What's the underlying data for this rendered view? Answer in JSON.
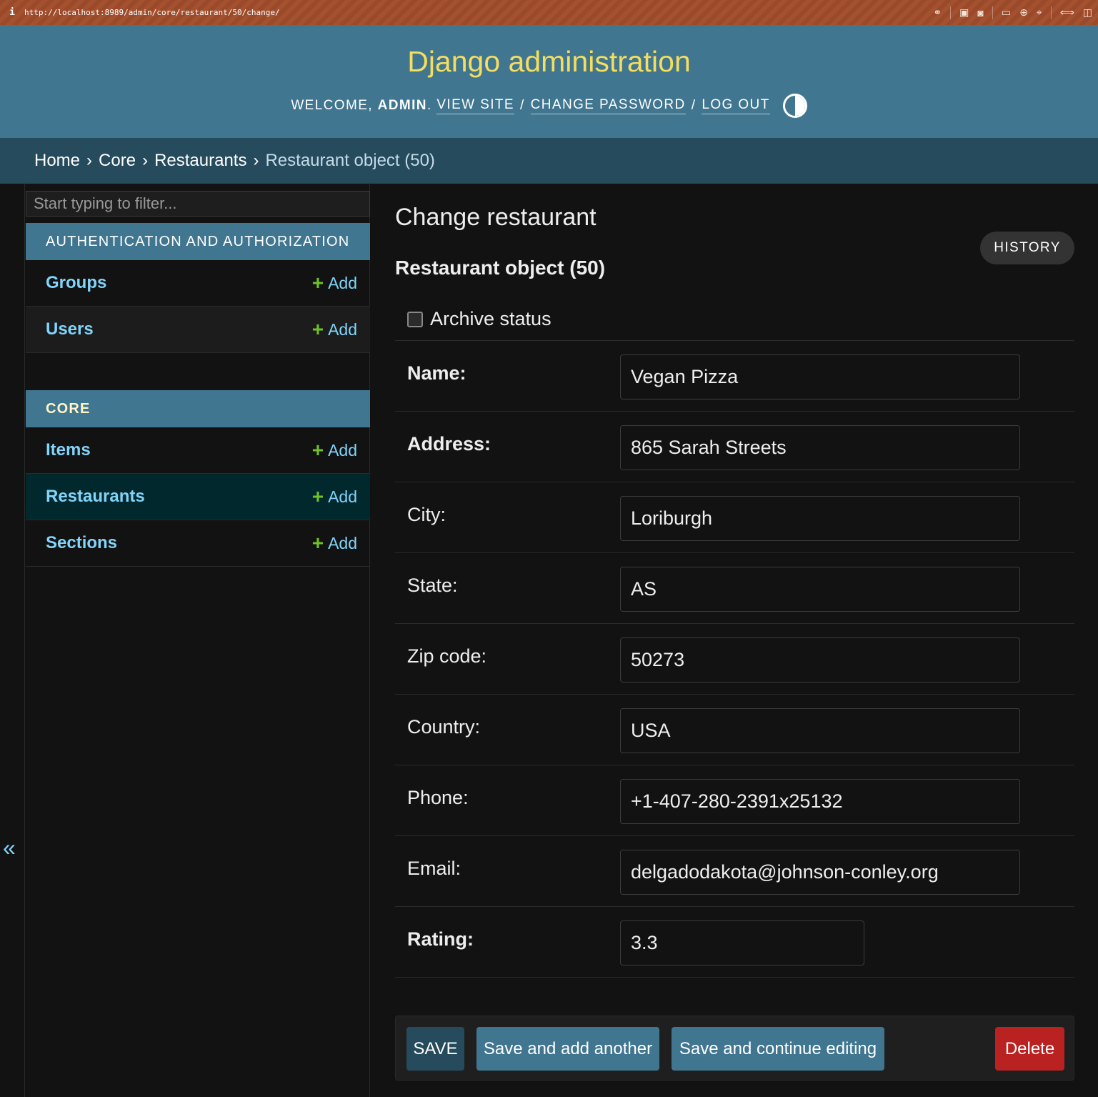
{
  "browser": {
    "info_glyph": "i",
    "url": "http://localhost:8989/admin/core/restaurant/50/change/"
  },
  "header": {
    "brand": "Django administration",
    "welcome": "WELCOME,",
    "user": "ADMIN",
    "user_suffix": ".",
    "view_site": "VIEW SITE",
    "change_password": "CHANGE PASSWORD",
    "log_out": "LOG OUT",
    "slash": "/"
  },
  "breadcrumbs": {
    "home": "Home",
    "app": "Core",
    "model": "Restaurants",
    "current": "Restaurant object (50)",
    "sep": "›"
  },
  "sidebar": {
    "filter_placeholder": "Start typing to filter...",
    "add_label": "Add",
    "modules": [
      {
        "caption": "AUTHENTICATION AND AUTHORIZATION",
        "models": [
          "Groups",
          "Users"
        ]
      },
      {
        "caption": "CORE",
        "models": [
          "Items",
          "Restaurants",
          "Sections"
        ]
      }
    ],
    "collapse_glyph": "«"
  },
  "content": {
    "page_title": "Change restaurant",
    "history_label": "HISTORY",
    "object_title": "Restaurant object (50)",
    "archive_label": "Archive status",
    "archive_checked": false,
    "fields": [
      {
        "label": "Name:",
        "value": "Vegan Pizza",
        "required": true
      },
      {
        "label": "Address:",
        "value": "865 Sarah Streets",
        "required": true
      },
      {
        "label": "City:",
        "value": "Loriburgh",
        "required": false
      },
      {
        "label": "State:",
        "value": "AS",
        "required": false
      },
      {
        "label": "Zip code:",
        "value": "50273",
        "required": false
      },
      {
        "label": "Country:",
        "value": "USA",
        "required": false
      },
      {
        "label": "Phone:",
        "value": "+1-407-280-2391x25132",
        "required": false
      },
      {
        "label": "Email:",
        "value": "delgadodakota@johnson-conley.org",
        "required": false
      },
      {
        "label": "Rating:",
        "value": "3.3",
        "required": true
      }
    ],
    "buttons": {
      "save": "SAVE",
      "save_add_another": "Save and add another",
      "save_continue": "Save and continue editing",
      "delete": "Delete"
    }
  },
  "colors": {
    "header_bg": "#417690",
    "brand_yellow": "#f5dd5d",
    "breadcrumb_bg": "#264b5d",
    "link_blue": "#81d4fa",
    "add_green": "#70bf2b",
    "delete_red": "#ba2121"
  }
}
